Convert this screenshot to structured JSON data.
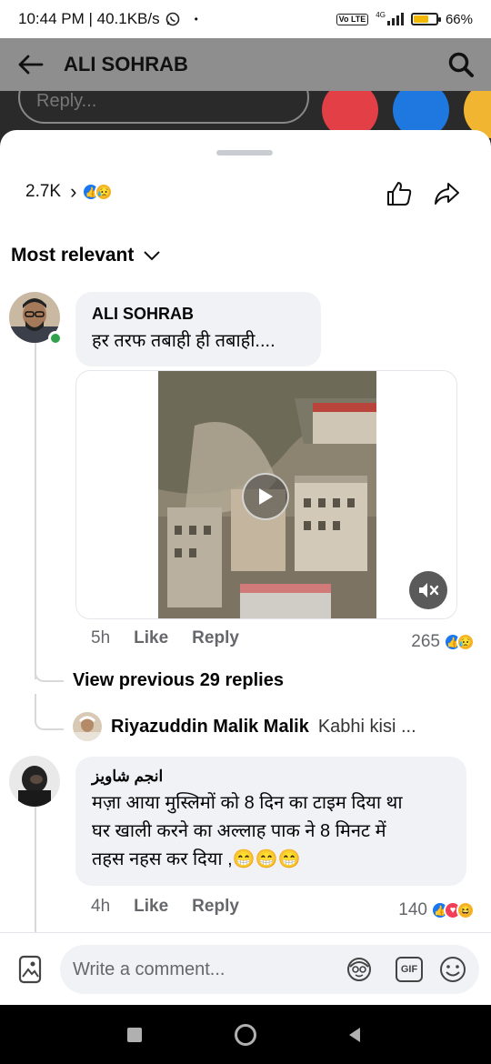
{
  "status_bar": {
    "time_speed": "10:44 PM | 40.1KB/s",
    "dot": "•",
    "volte": "Vo LTE",
    "network": "4G",
    "battery": "66%"
  },
  "header": {
    "title": "ALI SOHRAB"
  },
  "backdrop": {
    "reply_placeholder": "Reply..."
  },
  "reactions_summary": {
    "count": "2.7K"
  },
  "sort": {
    "label": "Most relevant"
  },
  "comments": [
    {
      "author": "ALI SOHRAB",
      "text": "हर तरफ तबाही ही तबाही....",
      "time": "5h",
      "like_label": "Like",
      "reply_label": "Reply",
      "reaction_count": "265",
      "view_previous": "View previous 29 replies",
      "latest_reply": {
        "author": "Riyazuddin Malik Malik",
        "snippet": "Kabhi kisi ..."
      }
    },
    {
      "author": "انجم شاویز",
      "text_lines": [
        "मज़ा आया मुस्लिमों को 8 दिन का टाइम दिया था",
        "घर खाली करने का अल्लाह पाक ने 8 मिनट में",
        "तहस नहस कर दिया ,😁😁😁"
      ],
      "time": "4h",
      "like_label": "Like",
      "reply_label": "Reply",
      "reaction_count": "140"
    }
  ],
  "composer": {
    "placeholder": "Write a comment...",
    "gif_label": "GIF"
  },
  "colors": {
    "accent": "#1877f2",
    "online": "#31a24c",
    "bubble": "#f0f2f5"
  }
}
